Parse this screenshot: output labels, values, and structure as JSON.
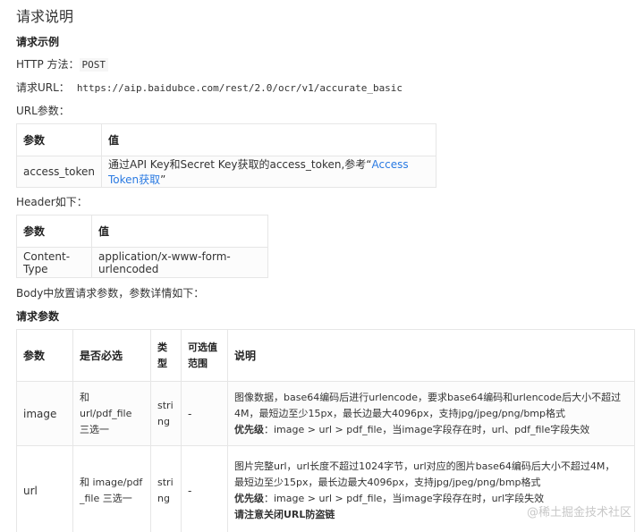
{
  "title": "请求说明",
  "example_heading": "请求示例",
  "http_method_label": "HTTP 方法：",
  "http_method_value": "POST",
  "request_url_label": "请求URL：",
  "request_url_value": "https://aip.baidubce.com/rest/2.0/ocr/v1/accurate_basic",
  "url_params_label": "URL参数：",
  "url_table": {
    "headers": [
      "参数",
      "值"
    ],
    "row": {
      "param": "access_token",
      "desc_prefix": "通过API Key和Secret Key获取的access_token,参考“",
      "link": "Access Token获取",
      "desc_suffix": "”"
    }
  },
  "header_label": "Header如下：",
  "header_table": {
    "headers": [
      "参数",
      "值"
    ],
    "row": {
      "param": "Content-Type",
      "value": "application/x-www-form-urlencoded"
    }
  },
  "body_label": "Body中放置请求参数，参数详情如下：",
  "params_heading": "请求参数",
  "params_table": {
    "headers": {
      "param": "参数",
      "required_line": "是否必选",
      "type_1": "类",
      "type_2": "型",
      "range_1": "可选值",
      "range_2": "范围",
      "desc": "说明"
    },
    "rows": [
      {
        "param": "image",
        "required_1": "和 url/pdf_file",
        "required_2": "三选一",
        "type_1": "stri",
        "type_2": "ng",
        "range": "-",
        "desc_1": "图像数据，base64编码后进行urlencode，要求base64编码和urlencode后大小不超过",
        "desc_2": "4M，最短边至少15px，最长边最大4096px，支持jpg/jpeg/png/bmp格式",
        "priority_label": "优先级",
        "priority_text": "：image > url > pdf_file，当image字段存在时，url、pdf_file字段失效"
      },
      {
        "param": "url",
        "required_1": "和 image/pdf",
        "required_2": "_file 三选一",
        "type_1": "stri",
        "type_2": "ng",
        "range": "-",
        "desc_1": "图片完整url，url长度不超过1024字节，url对应的图片base64编码后大小不超过4M，",
        "desc_2": "最短边至少15px，最长边最大4096px，支持jpg/jpeg/png/bmp格式",
        "priority_label": "优先级",
        "priority_text": "：image > url > pdf_file，当image字段存在时，url字段失效",
        "note": "请注意关闭URL防盗链"
      }
    ]
  },
  "watermark": "@稀土掘金技术社区"
}
